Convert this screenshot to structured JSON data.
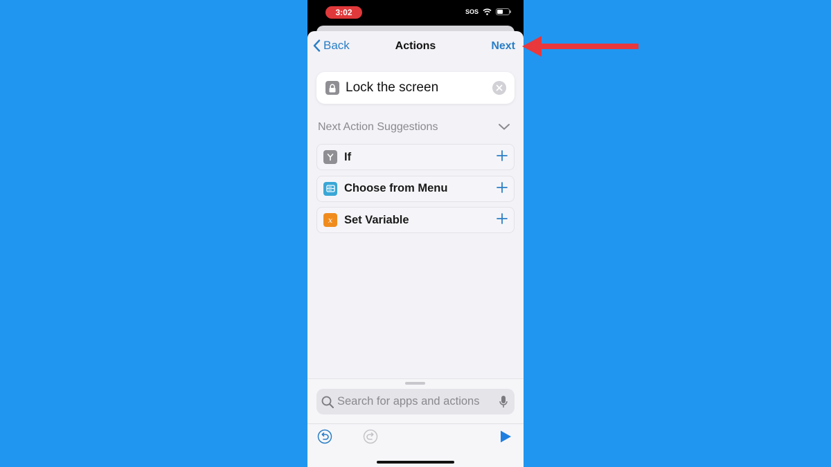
{
  "status_bar": {
    "time": "3:02",
    "carrier": "SOS",
    "time_pill_color": "#e0393b"
  },
  "nav": {
    "back_label": "Back",
    "title": "Actions",
    "next_label": "Next"
  },
  "selected_action": {
    "label": "Lock the screen",
    "icon": "lock-icon"
  },
  "suggestions": {
    "header": "Next Action Suggestions",
    "items": [
      {
        "label": "If",
        "icon": "branch-icon",
        "color": "#8e8e93"
      },
      {
        "label": "Choose from Menu",
        "icon": "menu-icon",
        "color": "#3aa7d6"
      },
      {
        "label": "Set Variable",
        "icon": "variable-icon",
        "color": "#f08c1e"
      }
    ]
  },
  "search": {
    "placeholder": "Search for apps and actions"
  },
  "colors": {
    "accent": "#2a7ec5",
    "background": "#2196f0",
    "annotation_arrow": "#e8383c"
  },
  "annotation": {
    "arrow_target": "Next"
  }
}
